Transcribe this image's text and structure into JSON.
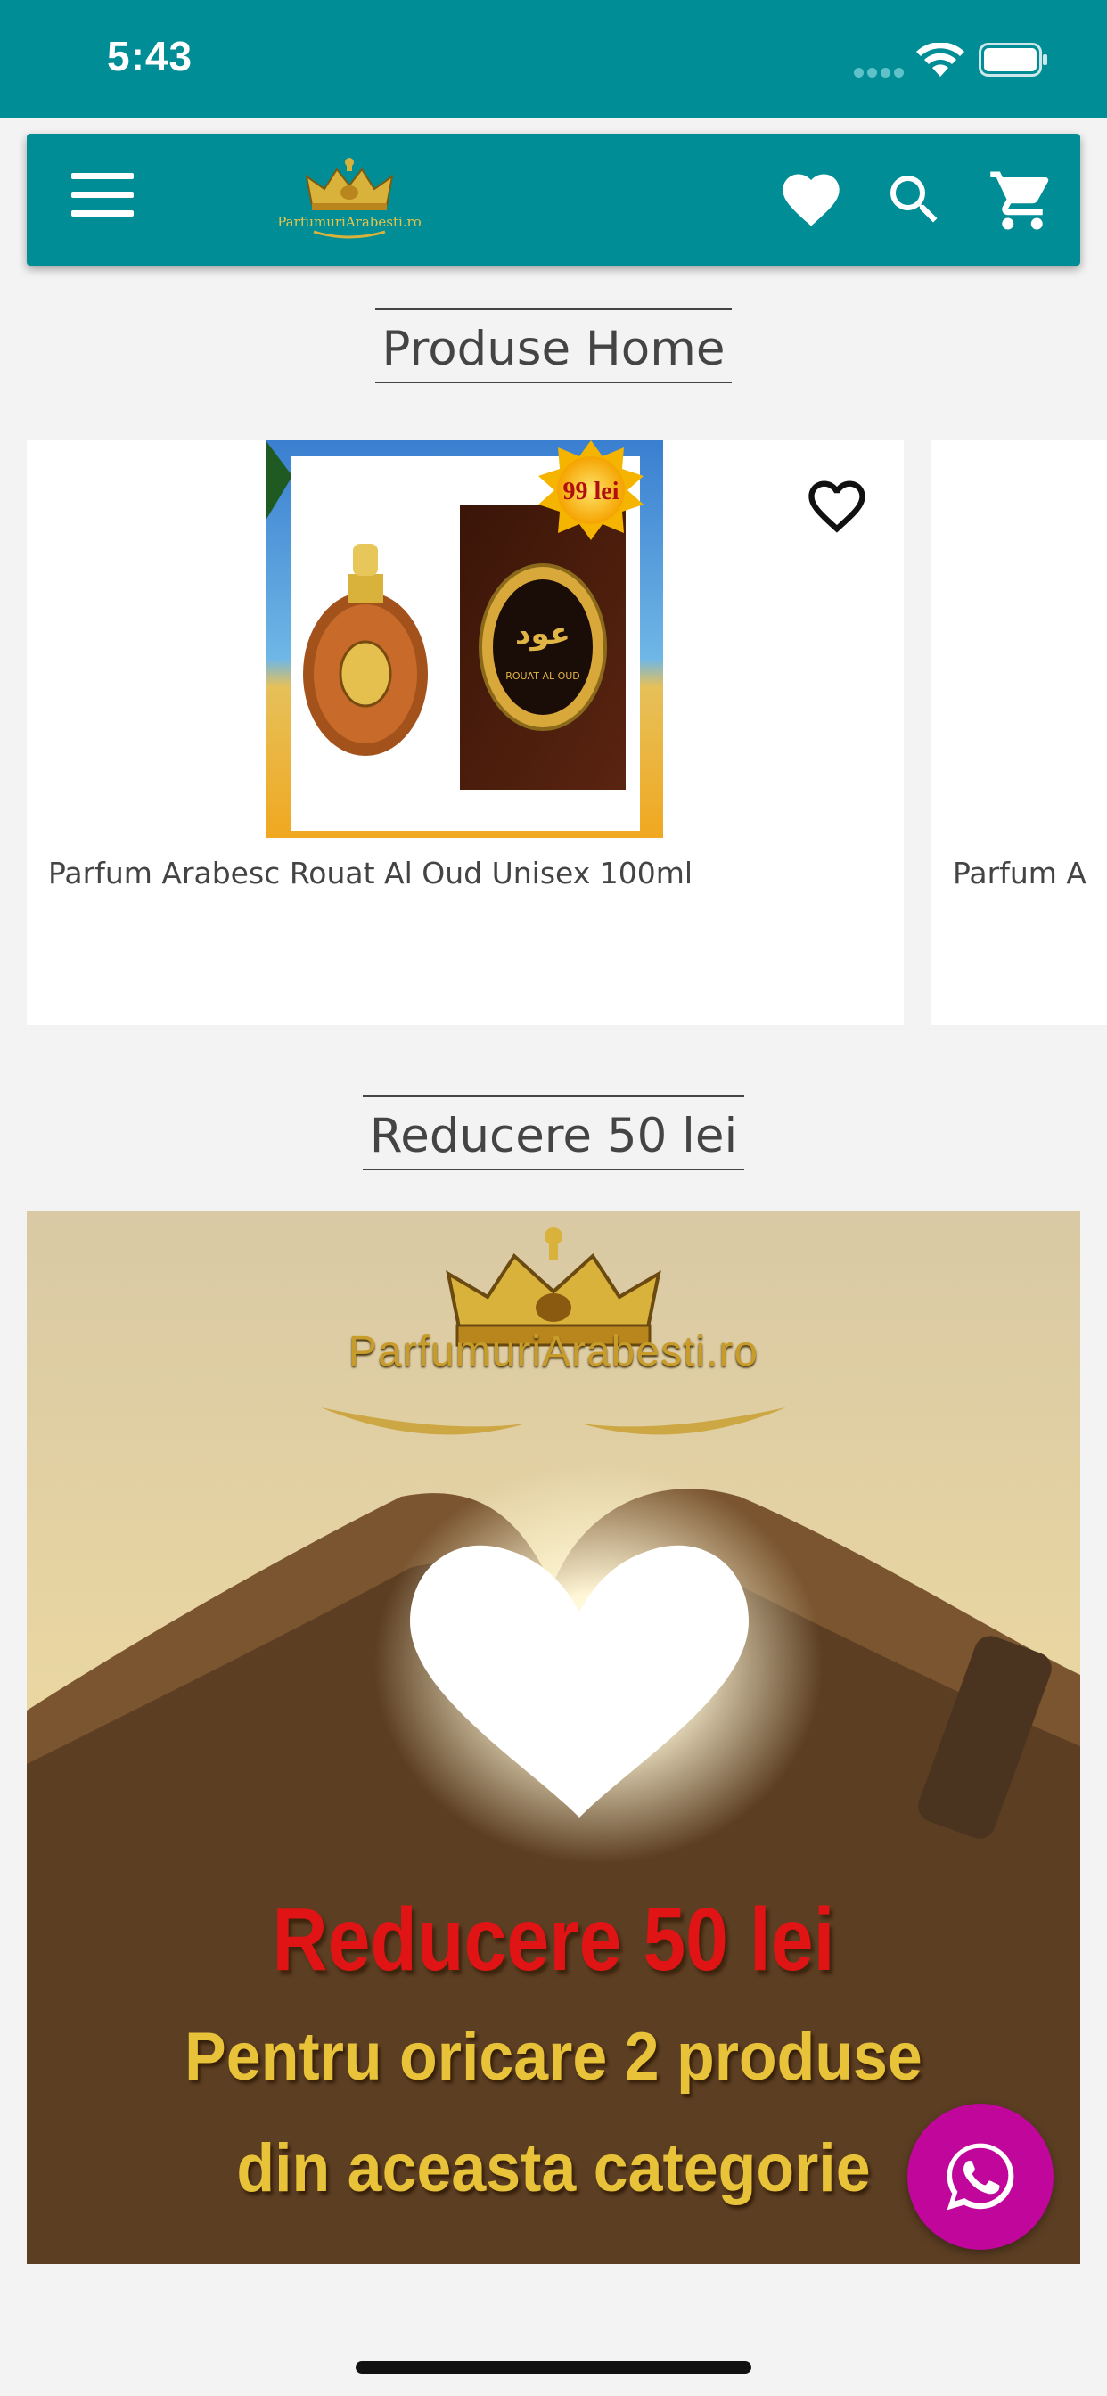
{
  "status_bar": {
    "time": "5:43"
  },
  "app_bar": {
    "menu_icon": "menu-icon",
    "logo_text": "ParfumuriArabesti.ro",
    "icons": [
      "heart-icon",
      "search-icon",
      "cart-icon"
    ]
  },
  "sections": {
    "products_title": "Produse Home",
    "promo_title": "Reducere 50 lei"
  },
  "products": [
    {
      "name": "Parfum Arabesc Rouat Al Oud Unisex 100ml",
      "price_badge": "99 lei"
    },
    {
      "name": "Parfum A"
    }
  ],
  "promo_banner": {
    "brand": "ParfumuriArabesti.ro",
    "headline": "Reducere 50 lei",
    "line1": "Pentru oricare 2 produse",
    "line2": "din aceasta categorie"
  },
  "colors": {
    "primary": "#008d95",
    "whatsapp": "#c0069b",
    "promo_red": "#e01414",
    "promo_gold": "#e8c33a"
  }
}
